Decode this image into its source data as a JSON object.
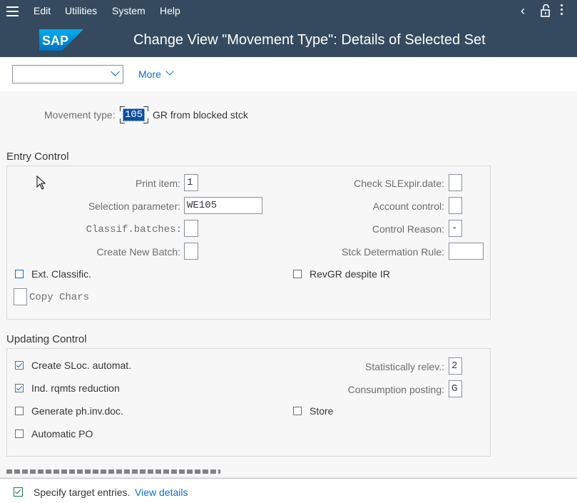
{
  "menubar": {
    "items": [
      "Edit",
      "Utilities",
      "System",
      "Help"
    ],
    "back_icon": "chevron-left-icon",
    "lock_icon": "unlock-icon",
    "more_icon": "vertical-ellipsis-icon"
  },
  "header": {
    "logo": "SAP",
    "title": "Change View \"Movement Type\": Details of Selected Set"
  },
  "toolbar": {
    "dropdown_value": "",
    "more_label": "More"
  },
  "movement_type": {
    "label": "Movement type:",
    "value": "105",
    "description": "GR from blocked stck"
  },
  "entry_control": {
    "title": "Entry Control",
    "print_item_label": "Print item:",
    "print_item_value": "1",
    "selection_parameter_label": "Selection parameter:",
    "selection_parameter_value": "WE105",
    "classif_batches_label": "Classif.batches:",
    "classif_batches_value": "",
    "create_new_batch_label": "Create New Batch:",
    "create_new_batch_value": "",
    "check_slexpir_label": "Check SLExpir.date:",
    "check_slexpir_value": "",
    "account_control_label": "Account control:",
    "account_control_value": "",
    "control_reason_label": "Control Reason:",
    "control_reason_value": "-",
    "stck_determination_label": "Stck Determation Rule:",
    "stck_determination_value": "",
    "ext_classific_label": "Ext. Classific.",
    "ext_classific_checked": false,
    "revgr_label": "RevGR despite IR",
    "revgr_checked": false,
    "copy_chars_label": "Copy Chars",
    "copy_chars_value": ""
  },
  "updating_control": {
    "title": "Updating Control",
    "create_sloc_label": "Create SLoc. automat.",
    "create_sloc_checked": true,
    "ind_rqmts_label": "Ind. rqmts reduction",
    "ind_rqmts_checked": true,
    "generate_phinv_label": "Generate ph.inv.doc.",
    "generate_phinv_checked": false,
    "automatic_po_label": "Automatic PO",
    "automatic_po_checked": false,
    "statistically_relev_label": "Statistically relev.:",
    "statistically_relev_value": "2",
    "consumption_posting_label": "Consumption posting:",
    "consumption_posting_value": "G",
    "store_label": "Store",
    "store_checked": false
  },
  "message": {
    "text": "Specify target entries.",
    "link": "View details"
  }
}
